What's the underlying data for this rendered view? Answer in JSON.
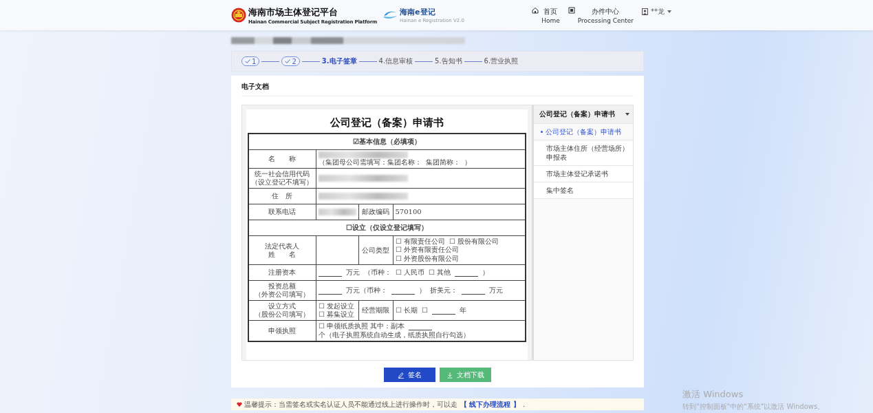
{
  "header": {
    "platform_title": "海南市场主体登记平台",
    "platform_subtitle": "Hainan Commercial Subject Registration Platform",
    "brand_title": "海南e登记",
    "brand_subtitle": "Hainan e Registration V2.0",
    "nav": [
      {
        "kind": "home",
        "label": "首页",
        "sublabel": "Home"
      },
      {
        "kind": "center",
        "label": "办件中心",
        "sublabel": "Processing Center"
      }
    ],
    "user": "**龙"
  },
  "applicant": {
    "kind": "redacted"
  },
  "steps": [
    {
      "label": "1",
      "done": true,
      "current": false
    },
    {
      "label": "2",
      "done": true,
      "current": false
    },
    {
      "label": "3.电子签章",
      "done": false,
      "current": true
    },
    {
      "label": "4.信息审核",
      "done": false,
      "current": false
    },
    {
      "label": "5.告知书",
      "done": false,
      "current": false
    },
    {
      "label": "6.营业执照",
      "done": false,
      "current": false
    }
  ],
  "section_title": "电子文档",
  "document": {
    "title": "公司登记（备案）申请书",
    "rows": [
      {
        "cells": [
          {
            "kind": "head",
            "colspan": 4,
            "lines": [
              [
                "☑基本信息（必填项）"
              ]
            ]
          }
        ]
      },
      {
        "cells": [
          {
            "kind": "label",
            "lines": [
              [
                "名　　称"
              ]
            ]
          },
          {
            "kind": "value",
            "colspan": 3,
            "lines": [
              [
                {
                  "kind": "redacted"
                }
              ],
              [
                "（集团母公司需填写：集团名称：",
                "集团简称：",
                "）"
              ]
            ]
          }
        ]
      },
      {
        "cells": [
          {
            "kind": "label",
            "lines": [
              [
                "统一社会信用代码"
              ],
              [
                "（设立登记不填写）"
              ]
            ]
          },
          {
            "kind": "value",
            "colspan": 3,
            "lines": [
              [
                {
                  "kind": "redacted"
                }
              ]
            ]
          }
        ]
      },
      {
        "cells": [
          {
            "kind": "label",
            "lines": [
              [
                "住　所"
              ]
            ]
          },
          {
            "kind": "value",
            "colspan": 3,
            "lines": [
              [
                {
                  "kind": "redacted"
                }
              ]
            ]
          }
        ]
      },
      {
        "cells": [
          {
            "kind": "label",
            "lines": [
              [
                "联系电话"
              ]
            ]
          },
          {
            "kind": "value",
            "lines": [
              [
                {
                  "kind": "redacted"
                }
              ]
            ]
          },
          {
            "kind": "label",
            "lines": [
              [
                "邮政编码"
              ]
            ]
          },
          {
            "kind": "value",
            "lines": [
              [
                "570100"
              ]
            ]
          }
        ]
      },
      {
        "cells": [
          {
            "kind": "head",
            "colspan": 4,
            "lines": [
              [
                "☐设立（仅设立登记填写）"
              ]
            ]
          }
        ]
      },
      {
        "cells": [
          {
            "kind": "label",
            "lines": [
              [
                "法定代表人"
              ],
              [
                "姓　　名"
              ]
            ]
          },
          {
            "kind": "value"
          },
          {
            "kind": "label",
            "lines": [
              [
                "公司类型"
              ]
            ]
          },
          {
            "kind": "value",
            "lines": [
              [
                "☐ 有限责任公司",
                "☐ 股份有限公司"
              ],
              [
                "☐ 外资有限责任公司",
                "☐ 外资股份有限公司"
              ]
            ]
          }
        ]
      },
      {
        "cells": [
          {
            "kind": "label",
            "lines": [
              [
                "注册资本"
              ]
            ]
          },
          {
            "kind": "value",
            "colspan": 3,
            "lines": [
              [
                {
                  "kind": "blank"
                },
                "万元",
                "（币种：",
                "☐ 人民币",
                "☐ 其他",
                {
                  "kind": "blank"
                },
                "）"
              ]
            ]
          }
        ]
      },
      {
        "cells": [
          {
            "kind": "label",
            "lines": [
              [
                "投资总额"
              ],
              [
                "（外资公司填写）"
              ]
            ]
          },
          {
            "kind": "value",
            "colspan": 3,
            "lines": [
              [
                {
                  "kind": "blank"
                },
                "万元（币种：",
                {
                  "kind": "blank"
                },
                "）",
                "折美元：",
                {
                  "kind": "blank"
                },
                "万元"
              ]
            ]
          }
        ]
      },
      {
        "cells": [
          {
            "kind": "label",
            "lines": [
              [
                "设立方式"
              ],
              [
                "（股份公司填写）"
              ]
            ]
          },
          {
            "kind": "value",
            "lines": [
              [
                "☐ 发起设立"
              ],
              [
                "☐ 募集设立"
              ]
            ]
          },
          {
            "kind": "label",
            "lines": [
              [
                "经营期限"
              ]
            ]
          },
          {
            "kind": "value",
            "lines": [
              [
                "☐ 长期",
                "☐",
                {
                  "kind": "blank"
                },
                "年"
              ]
            ]
          }
        ]
      },
      {
        "cells": [
          {
            "kind": "label",
            "lines": [
              [
                "申领执照"
              ]
            ]
          },
          {
            "kind": "value",
            "colspan": 3,
            "lines": [
              [
                "☐ 申领纸质执照 其中：副本",
                {
                  "kind": "blank"
                },
                "个（电子执照系统自动生成，纸质执照自行勾选）"
              ]
            ]
          }
        ]
      }
    ]
  },
  "doc_list": {
    "title": "公司登记（备案）申请书",
    "items": [
      {
        "label": "公司登记（备案）申请书",
        "selected": true
      },
      {
        "label": "市场主体住所（经营场所）申报表",
        "selected": false
      },
      {
        "label": "市场主体登记承诺书",
        "selected": false
      },
      {
        "label": "集中签名",
        "selected": false
      }
    ]
  },
  "buttons": [
    {
      "kind": "sign",
      "label": "签名"
    },
    {
      "kind": "download",
      "label": "文档下载"
    }
  ],
  "tip": {
    "text": "温馨提示：当需签名或实名认证人员不能通过线上进行操作时，可以走",
    "link": "【 线下办理流程 】",
    "end": "."
  },
  "os_notice": {
    "title": "激活 Windows",
    "text": "转到\"控制面板\"中的\"系统\"以激活 Windows。"
  }
}
